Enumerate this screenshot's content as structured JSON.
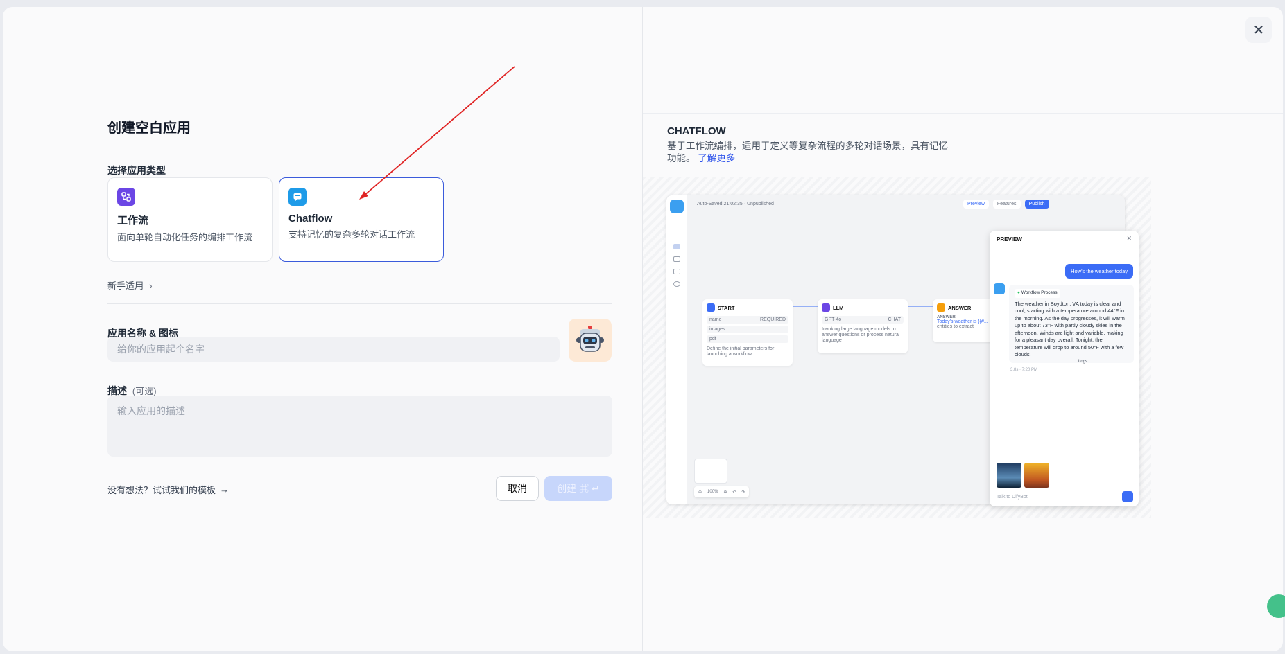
{
  "dialog": {
    "title": "创建空白应用",
    "choose_type_label": "选择应用类型",
    "types": [
      {
        "name": "工作流",
        "desc": "面向单轮自动化任务的编排工作流",
        "icon": "workflow-icon",
        "color": "#6b46e5"
      },
      {
        "name": "Chatflow",
        "desc": "支持记忆的复杂多轮对话工作流",
        "icon": "chat-bubble-icon",
        "color": "#1e9be8"
      }
    ],
    "beginner_label": "新手适用",
    "name_label": "应用名称 & 图标",
    "name_placeholder": "给你的应用起个名字",
    "desc_label": "描述",
    "desc_optional": "(可选)",
    "desc_placeholder": "输入应用的描述",
    "template_link": "没有想法？试试我们的模板",
    "cancel_label": "取消",
    "create_label": "创建 ⌘ ↵"
  },
  "preview": {
    "title": "CHATFLOW",
    "desc": "基于工作流编排，适用于定义等复杂流程的多轮对话场景，具有记忆功能。",
    "learn_more": "了解更多",
    "mock": {
      "autosave": "Auto-Saved 21:02:35 · Unpublished",
      "preview_btn": "Preview",
      "features_btn": "Features",
      "publish_btn": "Publish",
      "start_node": "START",
      "start_vars": [
        "name",
        "images",
        "pdf"
      ],
      "start_required": "REQUIRED",
      "start_desc": "Define the initial parameters for launching a workflow",
      "llm_node": "LLM",
      "llm_model": "GPT-4o",
      "llm_tag": "CHAT",
      "llm_desc": "Invoking large language models to answer questions or process natural language",
      "answer_node": "ANSWER",
      "answer_label": "ANSWER",
      "answer_text": "Today's weather is {{#...",
      "answer_text2": "entities to extract",
      "zoom": "100%",
      "preview_panel_title": "PREVIEW",
      "user_msg": "How's the weather today",
      "workflow_process": "Workflow Process",
      "bot_msg": "The weather in Boydton, VA today is clear and cool, starting with a temperature around 44°F in the morning. As the day progresses, it will warm up to about 73°F with partly cloudy skies in the afternoon. Winds are light and variable, making for a pleasant day overall. Tonight, the temperature will drop to around 50°F with a few clouds.",
      "logs": "Logs",
      "meta": "3.8s · 7:20 PM",
      "input_placeholder": "Talk to DifyBot"
    }
  }
}
